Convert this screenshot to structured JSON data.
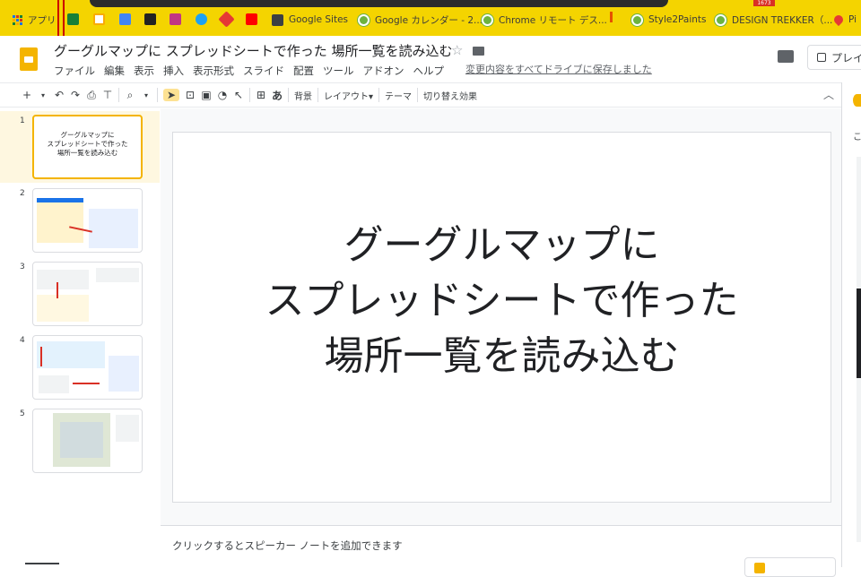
{
  "bookmarks": {
    "apps_label": "アプリ",
    "items": [
      {
        "label": "Google Sites"
      },
      {
        "label": "Google カレンダー - 2..."
      },
      {
        "label": "Chrome リモート デス..."
      },
      {
        "label": "Style2Paints"
      },
      {
        "label": "DESIGN TREKKER（..."
      },
      {
        "label": "Pi"
      }
    ],
    "badge": "1673"
  },
  "doc": {
    "title": "グーグルマップに スプレッドシートで作った 場所一覧を読み込む",
    "saved_status": "変更内容をすべてドライブに保存しました",
    "menu": [
      "ファイル",
      "編集",
      "表示",
      "挿入",
      "表示形式",
      "スライド",
      "配置",
      "ツール",
      "アドオン",
      "ヘルプ"
    ],
    "present_label": "プレイ"
  },
  "toolbar": {
    "text_items": [
      "背景",
      "レイアウト▾",
      "テーマ",
      "切り替え効果"
    ],
    "input_tool": "あ"
  },
  "filmstrip": {
    "slides": [
      {
        "number": "1",
        "text": "グーグルマップに\nスプレッドシートで作った\n場所一覧を読み込む"
      },
      {
        "number": "2"
      },
      {
        "number": "3"
      },
      {
        "number": "4"
      },
      {
        "number": "5"
      }
    ]
  },
  "slide": {
    "title_line1": "グーグルマップに",
    "title_line2": "スプレッドシートで作った",
    "title_line3": "場所一覧を読み込む"
  },
  "notes": {
    "placeholder": "クリックするとスピーカー ノートを追加できます"
  },
  "side_panel": {
    "header_text": "こ"
  },
  "colors": {
    "bookmark_bar": "#f4d400",
    "accent": "#f4b400",
    "selection": "#fef7e0"
  }
}
